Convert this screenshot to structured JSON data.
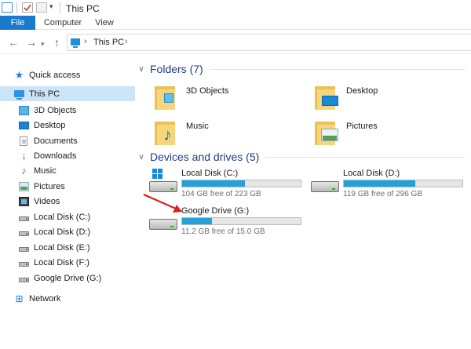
{
  "window": {
    "title": "This PC"
  },
  "ribbon": {
    "tabs": [
      "File",
      "Computer",
      "View"
    ]
  },
  "address": {
    "path": "This PC",
    "back_glyph": "←",
    "forward_glyph": "→",
    "up_glyph": "↑",
    "chevron_glyph": "›"
  },
  "sidebar": {
    "items": [
      {
        "label": "Quick access",
        "icon": "star-icon"
      },
      {
        "label": "This PC",
        "icon": "pc-icon",
        "selected": true
      },
      {
        "label": "3D Objects",
        "icon": "cube-icon"
      },
      {
        "label": "Desktop",
        "icon": "desktop-icon"
      },
      {
        "label": "Documents",
        "icon": "document-icon"
      },
      {
        "label": "Downloads",
        "icon": "download-icon"
      },
      {
        "label": "Music",
        "icon": "music-icon"
      },
      {
        "label": "Pictures",
        "icon": "pictures-icon"
      },
      {
        "label": "Videos",
        "icon": "video-icon"
      },
      {
        "label": "Local Disk (C:)",
        "icon": "drive-icon"
      },
      {
        "label": "Local Disk (D:)",
        "icon": "drive-icon"
      },
      {
        "label": "Local Disk (E:)",
        "icon": "drive-icon"
      },
      {
        "label": "Local Disk (F:)",
        "icon": "drive-icon"
      },
      {
        "label": "Google Drive (G:)",
        "icon": "drive-icon"
      },
      {
        "label": "Network",
        "icon": "network-icon"
      }
    ]
  },
  "folders": {
    "header": "Folders (7)",
    "items": [
      {
        "label": "3D Objects",
        "icon": "folder-3d-objects-icon"
      },
      {
        "label": "Desktop",
        "icon": "folder-desktop-icon"
      },
      {
        "label": "Music",
        "icon": "folder-music-icon"
      },
      {
        "label": "Pictures",
        "icon": "folder-pictures-icon"
      }
    ]
  },
  "drives": {
    "header": "Devices and drives (5)",
    "items": [
      {
        "name": "Local Disk (C:)",
        "free": "104 GB free of 223 GB",
        "used_fraction": 0.53,
        "icon": "windows-drive-icon"
      },
      {
        "name": "Local Disk (D:)",
        "free": "119 GB free of 296 GB",
        "used_fraction": 0.6,
        "icon": "drive-icon"
      },
      {
        "name": "Google Drive (G:)",
        "free": "11.2 GB free of 15.0 GB",
        "used_fraction": 0.25,
        "icon": "drive-icon"
      }
    ]
  },
  "colors": {
    "accent": "#1979ca",
    "selection": "#cce4f7",
    "bar_fill": "#26a0da",
    "arrow": "#d9221c"
  }
}
